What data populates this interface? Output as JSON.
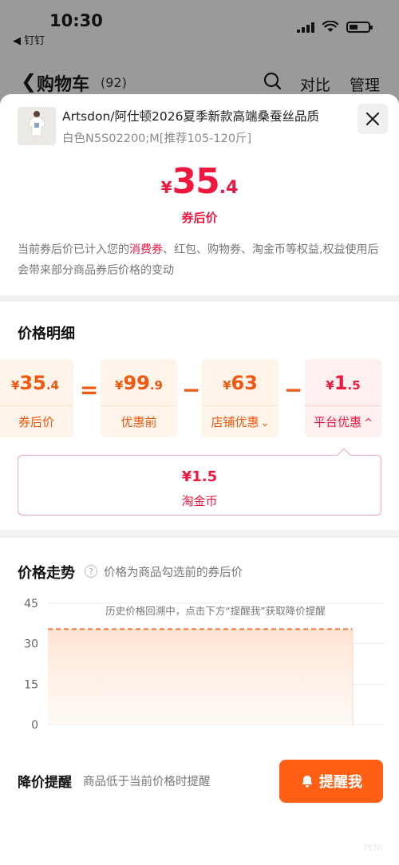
{
  "status": {
    "time": "10:30",
    "back_app": "◀ 钉钉"
  },
  "cart": {
    "title": "购物车",
    "count": "(92)",
    "compare_label": "对比",
    "manage_label": "管理"
  },
  "product": {
    "title": "Artsdon/阿仕顿2026夏季新款高端桑蚕丝品质",
    "spec": "白色N5S02200;M[推荐105-120斤]"
  },
  "price": {
    "currency": "¥",
    "integer": "35",
    "decimal": ".4",
    "caption": "券后价"
  },
  "note": {
    "part1": "当前券后价已计入您的",
    "highlight": "消费券",
    "part2": "、红包、购物券、淘金币等权益,权益使用后会带来部分商品券后价格的变动"
  },
  "detail": {
    "title": "价格明细",
    "boxes": [
      {
        "currency": "¥",
        "integer": "35",
        "decimal": ".4",
        "label": "券后价"
      },
      {
        "currency": "¥",
        "integer": "99",
        "decimal": ".9",
        "label": "优惠前"
      },
      {
        "currency": "¥",
        "integer": "63",
        "decimal": "",
        "label": "店铺优惠",
        "chevron": "⌄"
      },
      {
        "currency": "¥",
        "integer": "1",
        "decimal": ".5",
        "label": "平台优惠",
        "chevron": "^"
      }
    ],
    "operators": [
      "=",
      "−",
      "−"
    ],
    "sub": {
      "value": "¥1.5",
      "label": "淘金币"
    }
  },
  "trend": {
    "title": "价格走势",
    "help_icon": "?",
    "note": "价格为商品勾选前的券后价",
    "history_note": "历史价格回溯中，点击下方“提醒我”获取降价提醒"
  },
  "chart_data": {
    "type": "area",
    "title": "",
    "xlabel": "",
    "ylabel": "",
    "ylim": [
      0,
      45
    ],
    "yticks": [
      "45",
      "30",
      "15",
      "0"
    ],
    "grid": true,
    "series": [
      {
        "values": [
          35.4,
          35.4
        ]
      }
    ],
    "reference_line": 35.4,
    "colors": {
      "line": "#f5773a",
      "fill": "#fde3d2"
    }
  },
  "remind": {
    "label": "降价提醒",
    "note": "商品低于当前价格时提醒",
    "button_label": "提醒我",
    "button_icon": "bell-icon"
  },
  "watermark": "757it",
  "colors": {
    "accent_red": "#f0173f",
    "accent_orange": "#f0570f",
    "button_orange": "#fe5f14"
  }
}
